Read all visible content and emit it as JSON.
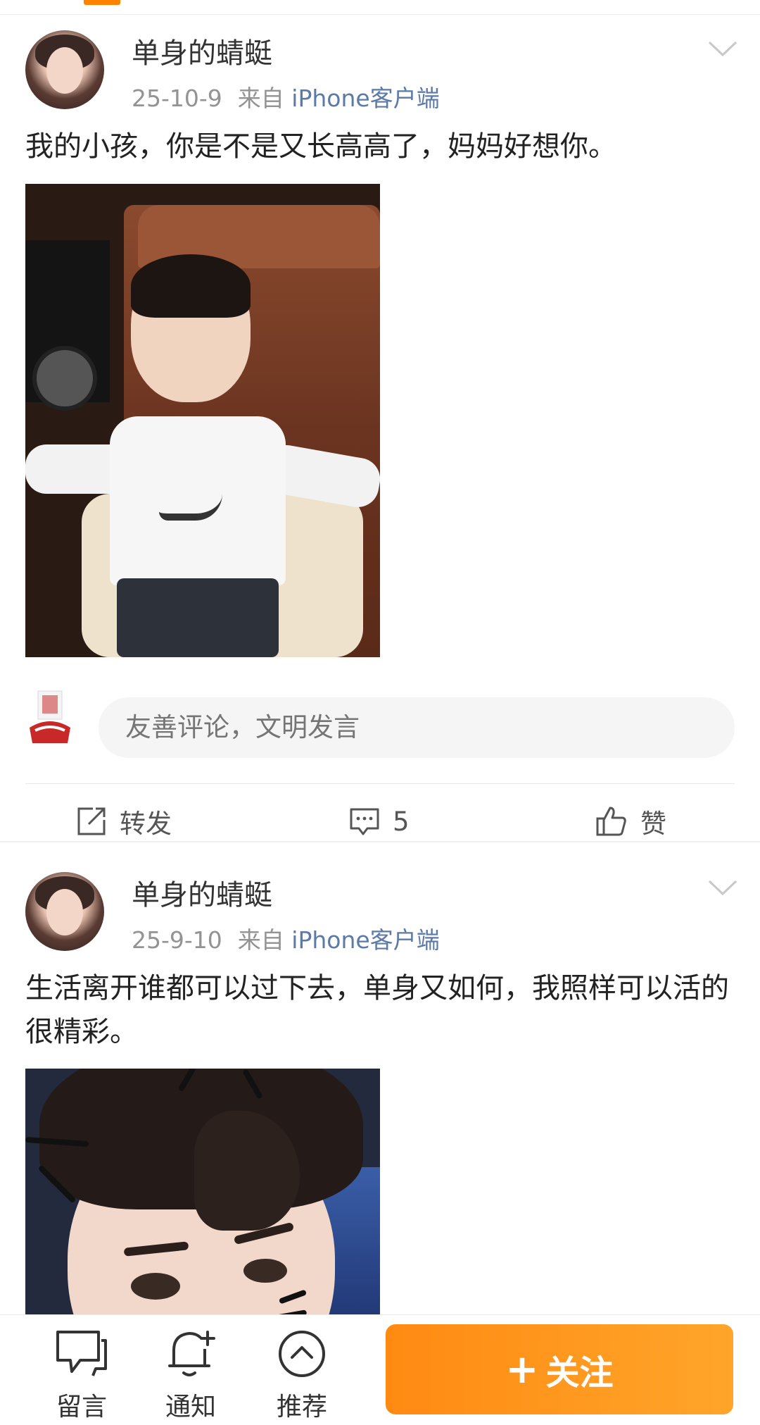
{
  "posts": [
    {
      "username": "单身的蜻蜓",
      "date": "25-10-9",
      "source_prefix": "来自",
      "source": "iPhone客户端",
      "text": "我的小孩，你是不是又长高高了，妈妈好想你。",
      "comment_placeholder": "友善评论，文明发言",
      "actions": {
        "repost_label": "转发",
        "comment_count": "5",
        "like_label": "赞"
      }
    },
    {
      "username": "单身的蜻蜓",
      "date": "25-9-10",
      "source_prefix": "来自",
      "source": "iPhone客户端",
      "text": "生活离开谁都可以过下去，单身又如何，我照样可以活的很精彩。"
    }
  ],
  "bottom_bar": {
    "message_label": "留言",
    "notify_label": "通知",
    "recommend_label": "推荐",
    "follow_plus": "+",
    "follow_label": "关注"
  },
  "colors": {
    "accent": "#ff8200",
    "link": "#5b7aa8",
    "follow_start": "#ff8a12",
    "follow_end": "#ffa52a"
  },
  "icons": {
    "chevron": "chevron-down-icon",
    "repost": "repost-icon",
    "comment": "comment-icon",
    "like": "thumbs-up-icon",
    "message": "message-icon",
    "notify": "bell-plus-icon",
    "recommend": "up-circle-icon"
  }
}
